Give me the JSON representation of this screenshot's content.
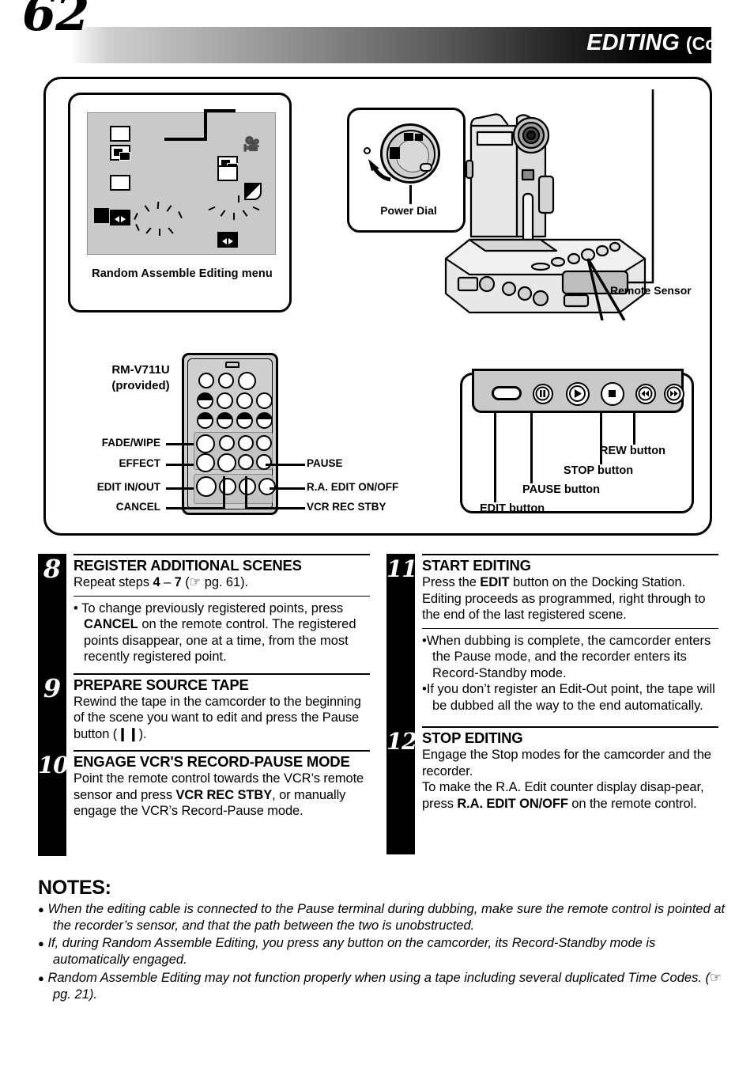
{
  "header": {
    "page_number": "62",
    "title": "EDITING",
    "title_cont": "(Cont.)"
  },
  "figure": {
    "menu_panel": {
      "caption": "Random Assemble Editing menu",
      "icons": [
        "blank-frame-icon",
        "overlap-frames-icon",
        "frame-icon",
        "arrows-icon",
        "solid-block-icon",
        "camera-icon",
        "fade-icon"
      ]
    },
    "power_dial": {
      "label": "Power Dial"
    },
    "camcorder": {
      "remote_sensor_label": "Remote Sensor"
    },
    "remote": {
      "model": "RM-V711U",
      "provided": "(provided)",
      "labels_left": [
        "FADE/WIPE",
        "EFFECT",
        "EDIT IN/OUT",
        "CANCEL"
      ],
      "labels_right": [
        "PAUSE",
        "R.A. EDIT ON/OFF",
        "VCR REC STBY"
      ]
    },
    "dock_panel": {
      "labels": [
        "REW button",
        "STOP button",
        "PAUSE button",
        "EDIT button"
      ]
    }
  },
  "steps": {
    "left": [
      {
        "number": "8",
        "title": "REGISTER ADDITIONAL SCENES",
        "body_pre": "Repeat steps ",
        "body_bold1": "4",
        "body_mid": " – ",
        "body_bold2": "7",
        "body_post": " ( pg. 61).",
        "bullets": [
          {
            "pre": "• To change previously registered points, press ",
            "bold": "CANCEL",
            "post": " on the remote control. The registered points disappear, one at a time, from the most recently registered point."
          }
        ]
      },
      {
        "number": "9",
        "title": "PREPARE SOURCE TAPE",
        "body": "Rewind the tape in the camcorder to the beginning of the scene you want to edit and press the Pause button (",
        "body_end": ")."
      },
      {
        "number": "10",
        "title": "ENGAGE VCR'S RECORD-PAUSE MODE",
        "body_pre": "Point the remote control towards the VCR’s remote sensor and press ",
        "body_bold": "VCR REC STBY",
        "body_post": ", or manually engage the VCR’s Record-Pause mode."
      }
    ],
    "right": [
      {
        "number": "11",
        "title": "START EDITING",
        "body_pre": "Press the ",
        "body_bold": "EDIT",
        "body_post": " button on the Docking Station. Editing proceeds as programmed, right through to the end of the last registered scene.",
        "bullets": [
          "•When dubbing is complete, the camcorder enters the Pause mode, and the recorder enters its Record-Standby mode.",
          "•If you don’t register an Edit-Out point, the tape will be dubbed all the way to the end automatically."
        ]
      },
      {
        "number": "12",
        "title": "STOP EDITING",
        "body_pre": "Engage the Stop modes for the camcorder and the recorder. To make the R.A. Edit counter display disap-pear, press ",
        "body_bold": "R.A. EDIT ON/OFF",
        "body_post": " on the remote control."
      }
    ]
  },
  "notes": {
    "title": "NOTES:",
    "items": [
      "When the editing cable is connected to the Pause terminal during dubbing, make sure the remote control is pointed at the recorder’s sensor, and that the path between the two is unobstructed.",
      "If, during Random Assemble Editing, you press any button on the camcorder, its Record-Standby mode is automatically engaged.",
      "Random Assemble Editing may not function properly when using a tape including several duplicated Time Codes. ( pg. 21)."
    ]
  }
}
